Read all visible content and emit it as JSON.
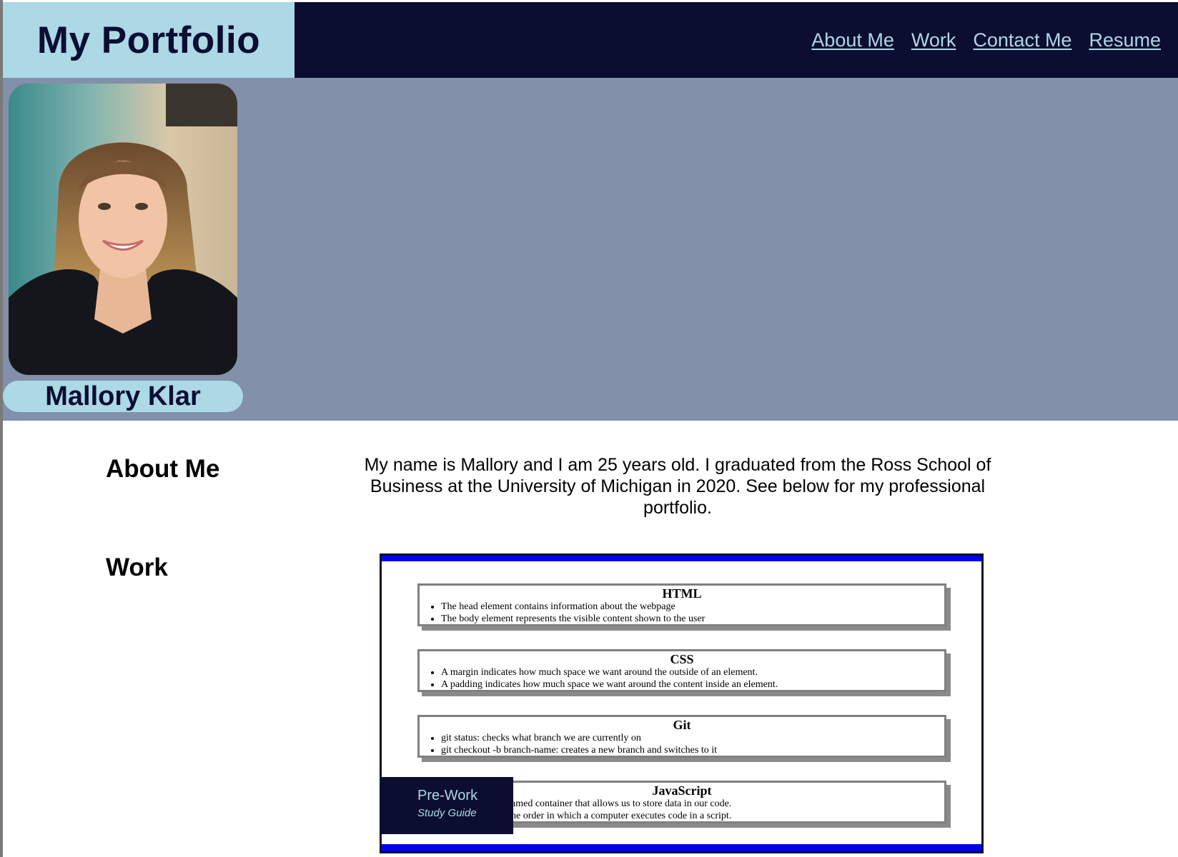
{
  "header": {
    "title": "My Portfolio",
    "nav": [
      "About Me",
      "Work",
      "Contact Me",
      "Resume"
    ]
  },
  "hero": {
    "name": "Mallory Klar",
    "photo_icon": "profile-photo"
  },
  "about": {
    "heading": "About Me",
    "text": "My name is Mallory and I am 25 years old. I graduated from the Ross School of Business at the University of Michigan in 2020. See below for my professional portfolio."
  },
  "work": {
    "heading": "Work",
    "project": {
      "title": "Pre-Work",
      "subtitle": "Study Guide",
      "sections": [
        {
          "title": "HTML",
          "items": [
            "The head element contains information about the webpage",
            "The body element represents the visible content shown to the user"
          ]
        },
        {
          "title": "CSS",
          "items": [
            "A margin indicates how much space we want around the outside of an element.",
            "A padding indicates how much space we want around the content inside an element."
          ]
        },
        {
          "title": "Git",
          "items": [
            "git status: checks what branch we are currently on",
            "git checkout -b branch-name: creates a new branch and switches to it"
          ]
        },
        {
          "title": "JavaScript",
          "items": [
            "amed container that allows us to store data in our code.",
            "he order in which a computer executes code in a script."
          ]
        }
      ]
    }
  },
  "colors": {
    "navy": "#0b0e31",
    "light_blue": "#add8e6",
    "slate": "#8290a9"
  }
}
